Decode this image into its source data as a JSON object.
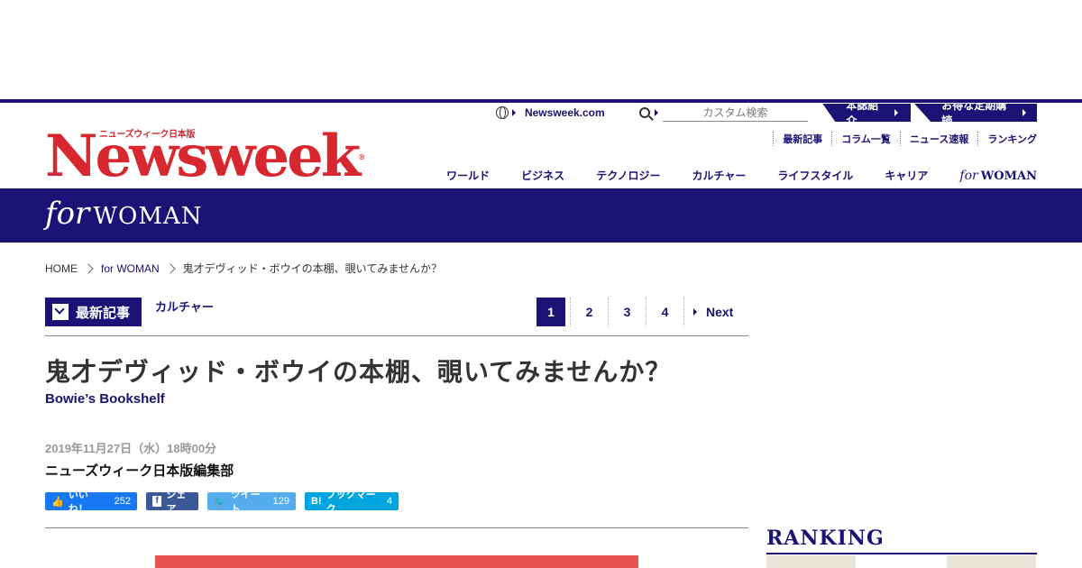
{
  "logo": {
    "sub": "ニューズウィーク日本版",
    "main": "Newsweek",
    "mark": "®"
  },
  "util": {
    "site_link": "Newsweek.com",
    "search_placeholder": "カスタム検索",
    "intro_btn": "本誌紹介",
    "subscribe_btn": "お得な定期購読"
  },
  "sub_links": [
    "最新記事",
    "コラム一覧",
    "ニュース速報",
    "ランキング"
  ],
  "main_nav": [
    "ワールド",
    "ビジネス",
    "テクノロジー",
    "カルチャー",
    "ライフスタイル",
    "キャリア"
  ],
  "nav_forwoman": {
    "for": "for",
    "woman": "WOMAN"
  },
  "band": {
    "for": "for",
    "woman": "WOMAN"
  },
  "breadcrumb": [
    "HOME",
    "for WOMAN",
    "鬼才デヴィッド・ボウイの本棚、覗いてみませんか？"
  ],
  "latest_label": "最新記事",
  "category": "カルチャー",
  "pager": {
    "pages": [
      "1",
      "2",
      "3",
      "4"
    ],
    "active": "1",
    "next": "Next"
  },
  "article": {
    "title": "鬼才デヴィッド・ボウイの本棚、覗いてみませんか？",
    "subtitle": "Bowie’s Bookshelf",
    "date": "2019年11月27日（水）18時00分",
    "author": "ニューズウィーク日本版編集部"
  },
  "shares": {
    "like_label": "いいね！",
    "like_count": "252",
    "fb_label": "シェア",
    "tw_label": "ツイート",
    "tw_count": "129",
    "hb_label": "ブックマーク",
    "hb_count": "4"
  },
  "ranking_title": "RANKING",
  "colors": {
    "brand_navy": "#1a1275",
    "logo_red": "#d7282f"
  }
}
